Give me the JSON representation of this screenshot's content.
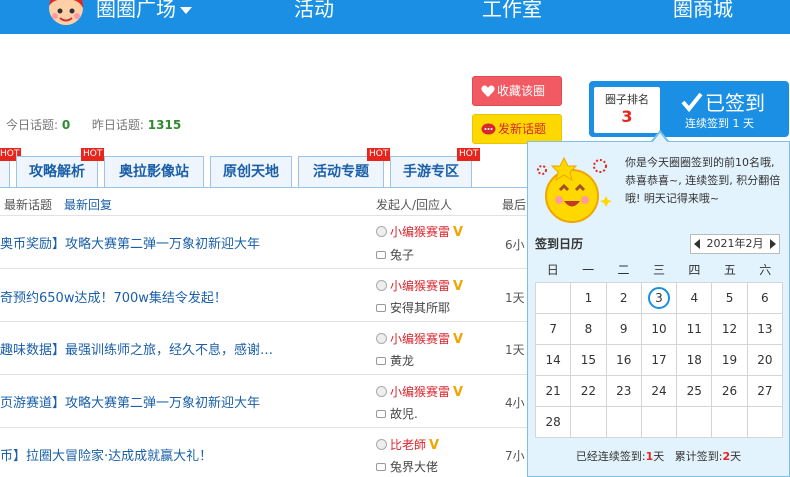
{
  "nav": {
    "items": [
      "圈圈广场",
      "活动",
      "工作室",
      "圈商城"
    ]
  },
  "stats": {
    "today_label": "今日话题:",
    "today_value": "0",
    "yesterday_label": "昨日话题:",
    "yesterday_value": "1315"
  },
  "actions": {
    "favorite_label": "收藏该圈",
    "new_topic_label": "发新话题"
  },
  "tabs": [
    {
      "label": "攻略解析"
    },
    {
      "label": "奥拉影像站"
    },
    {
      "label": "原创天地"
    },
    {
      "label": "活动专题"
    },
    {
      "label": "手游专区"
    }
  ],
  "hot_label": "HOT",
  "list_header": {
    "latest_topics": "最新话题",
    "latest_replies": "最新回复",
    "poster_replier": "发起人/回应人",
    "last": "最后"
  },
  "rows": [
    {
      "title": "奥币奖励】攻略大赛第二弹一万象初新迎大年",
      "author": "小编猴赛雷",
      "replier": "兔子",
      "time": "6小"
    },
    {
      "title": "奇预约650w达成！700w集结令发起！",
      "author": "小编猴赛雷",
      "replier": "安得其所耶",
      "time": "1天"
    },
    {
      "title": "趣味数据】最强训练师之旅，经久不息，感谢…",
      "author": "小编猴赛雷",
      "replier": "黄龙",
      "time": "1天"
    },
    {
      "title": "页游赛道】攻略大赛第二弹一万象初新迎大年",
      "author": "小编猴赛雷",
      "replier": "故児.",
      "time": "4小"
    },
    {
      "title": "币】拉圈大冒险家·达成成就赢大礼！",
      "author": "比老師",
      "replier": "兔界大佬",
      "time": "7小"
    }
  ],
  "vip_mark": "V",
  "rank": {
    "label": "圈子排名",
    "value": "3",
    "signed_label": "已签到",
    "streak_text": "连续签到 1 天"
  },
  "popup": {
    "message": "你是今天圈圈签到的前10名哦, 恭喜恭喜~, 连续签到, 积分翻倍哦! 明天记得来哦~",
    "calendar_title": "签到日历",
    "month": "2021年2月",
    "weekdays": [
      "日",
      "一",
      "二",
      "三",
      "四",
      "五",
      "六"
    ],
    "days": [
      "",
      "1",
      "2",
      "3",
      "4",
      "5",
      "6",
      "7",
      "8",
      "9",
      "10",
      "11",
      "12",
      "13",
      "14",
      "15",
      "16",
      "17",
      "18",
      "19",
      "20",
      "21",
      "22",
      "23",
      "24",
      "25",
      "26",
      "27",
      "28",
      "",
      "",
      "",
      "",
      "",
      ""
    ],
    "today": "3",
    "streak_label": "已经连续签到:",
    "streak_value": "1",
    "total_label": "累计签到:",
    "total_value": "2",
    "day_unit": "天"
  },
  "colors": {
    "nav_blue": "#1a8fe3",
    "link_blue": "#1a5fa8",
    "hot_red": "#e8251c",
    "fav_red": "#f25a63",
    "topic_yellow": "#ffd800",
    "popup_bg": "#e3f3fd"
  }
}
